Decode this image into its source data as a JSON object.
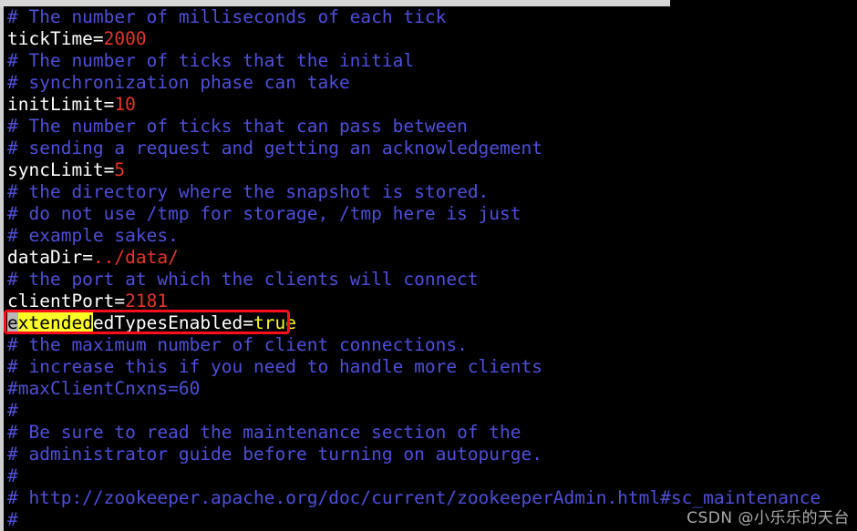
{
  "window": {
    "kind": "terminal-text-editor",
    "background_color": "#000000",
    "comment_color": "#4f4fd9",
    "text_color": "#ffffff",
    "value_color": "#e0382a",
    "highlight_box_color": "#fc0d1b",
    "search_match_color": "#fbfb28",
    "cursor_color": "#b8b8b8"
  },
  "scrollbars": {
    "horizontal_thumb_label": "horizontal-scroll-thumb",
    "vertical_thumb_label": "vertical-scroll-thumb"
  },
  "lines": [
    {
      "id": "l1",
      "type": "comment",
      "text": "# The number of milliseconds of each tick"
    },
    {
      "id": "l2",
      "type": "setting",
      "key": "tickTime",
      "value": "2000"
    },
    {
      "id": "l3",
      "type": "comment",
      "text": "# The number of ticks that the initial"
    },
    {
      "id": "l4",
      "type": "comment",
      "text": "# synchronization phase can take"
    },
    {
      "id": "l5",
      "type": "setting",
      "key": "initLimit",
      "value": "10"
    },
    {
      "id": "l6",
      "type": "comment",
      "text": "# The number of ticks that can pass between"
    },
    {
      "id": "l7",
      "type": "comment",
      "text": "# sending a request and getting an acknowledgement"
    },
    {
      "id": "l8",
      "type": "setting",
      "key": "syncLimit",
      "value": "5"
    },
    {
      "id": "l9",
      "type": "comment",
      "text": "# the directory where the snapshot is stored."
    },
    {
      "id": "l10",
      "type": "comment",
      "text": "# do not use /tmp for storage, /tmp here is just"
    },
    {
      "id": "l11",
      "type": "comment",
      "text": "# example sakes."
    },
    {
      "id": "l12",
      "type": "setting",
      "key": "dataDir",
      "value": "../data/"
    },
    {
      "id": "l13",
      "type": "comment",
      "text": "# the port at which the clients will connect"
    },
    {
      "id": "l14",
      "type": "setting",
      "key": "clientPort",
      "value": "2181"
    },
    {
      "id": "l15",
      "type": "highlighted-setting",
      "cursor_char": "e",
      "search_match": "xtended",
      "key_rest": "edTypesEnabled",
      "equals": "=",
      "value": "true",
      "full_text": "extendedTypesEnabled=true"
    },
    {
      "id": "l16",
      "type": "comment",
      "text": "# the maximum number of client connections."
    },
    {
      "id": "l17",
      "type": "comment",
      "text": "# increase this if you need to handle more clients"
    },
    {
      "id": "l18",
      "type": "comment",
      "text": "#maxClientCnxns=60"
    },
    {
      "id": "l19",
      "type": "comment",
      "text": "#"
    },
    {
      "id": "l20",
      "type": "comment",
      "text": "# Be sure to read the maintenance section of the"
    },
    {
      "id": "l21",
      "type": "comment",
      "text": "# administrator guide before turning on autopurge."
    },
    {
      "id": "l22",
      "type": "comment",
      "text": "#"
    },
    {
      "id": "l23",
      "type": "comment",
      "text": "# http://zookeeper.apache.org/doc/current/zookeeperAdmin.html#sc_maintenance"
    },
    {
      "id": "l24",
      "type": "comment",
      "text": "#"
    }
  ],
  "watermark": {
    "text": "CSDN @小乐乐的天台"
  }
}
